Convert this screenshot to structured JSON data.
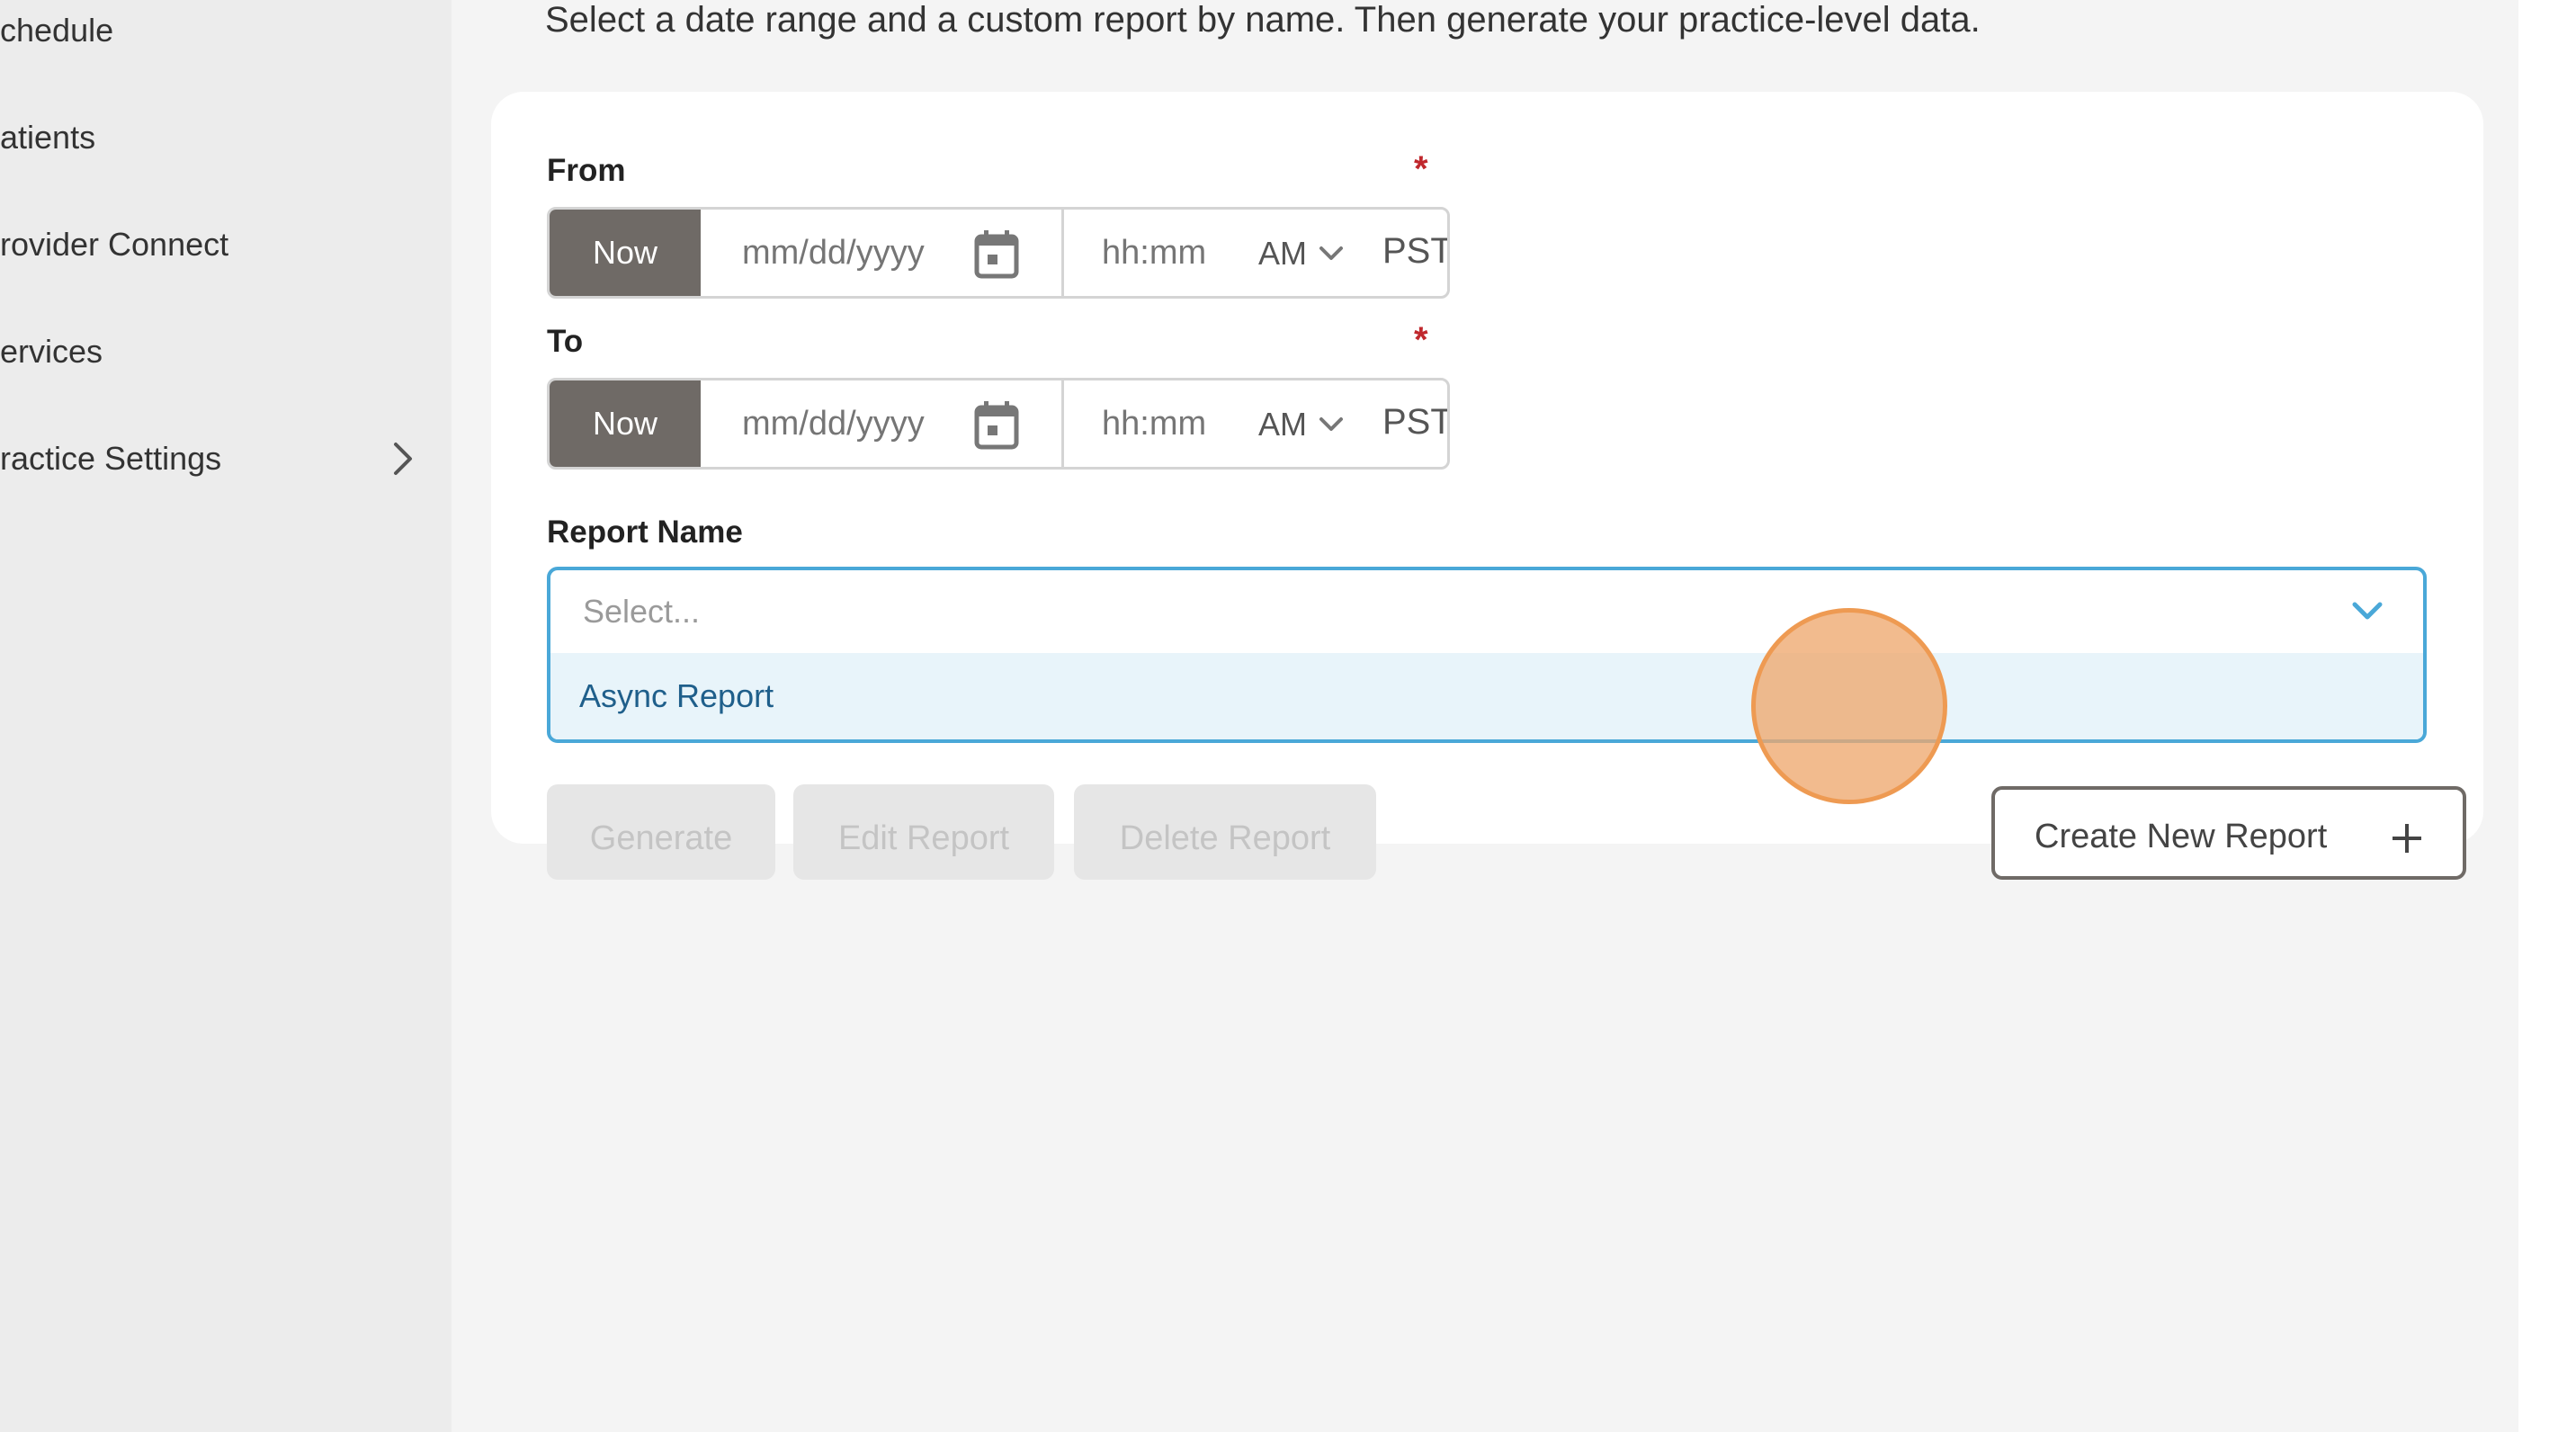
{
  "sidebar": {
    "items": [
      {
        "label": "chedule"
      },
      {
        "label": "atients"
      },
      {
        "label": "rovider Connect"
      },
      {
        "label": "ervices"
      },
      {
        "label": "ractice Settings"
      }
    ]
  },
  "main": {
    "intro": "Select a date range and a custom report by name. Then generate your practice-level data."
  },
  "form": {
    "from": {
      "label": "From",
      "required_mark": "*",
      "now_label": "Now",
      "date_placeholder": "mm/dd/yyyy",
      "time_placeholder": "hh:mm",
      "ampm": "AM",
      "timezone": "PST"
    },
    "to": {
      "label": "To",
      "required_mark": "*",
      "now_label": "Now",
      "date_placeholder": "mm/dd/yyyy",
      "time_placeholder": "hh:mm",
      "ampm": "AM",
      "timezone": "PST"
    },
    "report_name": {
      "label": "Report Name",
      "placeholder": "Select...",
      "options": [
        "Async Report"
      ]
    }
  },
  "actions": {
    "generate": "Generate",
    "edit": "Edit Report",
    "delete": "Delete Report",
    "create": "Create New Report"
  },
  "colors": {
    "now_button": "#6f6a66",
    "select_focus": "#4aa8d8",
    "required": "#c0282d",
    "option_highlight": "#e8f4fa",
    "click_indicator": "#ee9a52"
  }
}
